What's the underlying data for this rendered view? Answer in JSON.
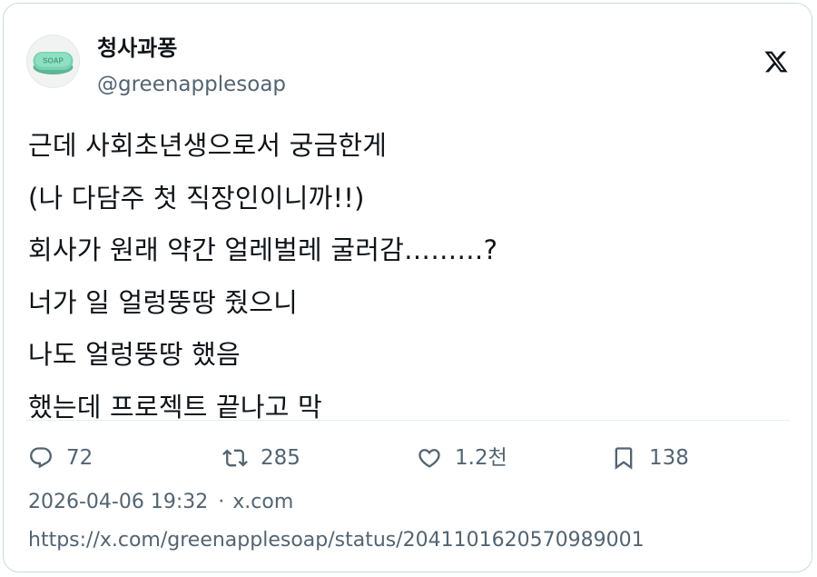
{
  "author": {
    "display_name": "청사과퐁",
    "handle": "@greenapplesoap",
    "avatar_icon": "green-soap-bar",
    "avatar_text": "SOAP"
  },
  "platform_icon": "x-logo-icon",
  "body_lines": [
    "근데 사회초년생으로서 궁금한게",
    "(나 다담주 첫 직장인이니까!!)",
    "회사가 원래 약간 얼레벌레 굴러감………?",
    "너가 일 얼렁뚱땅 줬으니",
    "나도 얼렁뚱땅 했음",
    "했는데 프로젝트 끝나고 막"
  ],
  "actions": {
    "reply": {
      "icon": "reply-bubble-icon",
      "count": "72"
    },
    "repost": {
      "icon": "repost-icon",
      "count": "285"
    },
    "like": {
      "icon": "heart-icon",
      "count": "1.2천"
    },
    "bookmark": {
      "icon": "bookmark-icon",
      "count": "138"
    }
  },
  "meta": {
    "timestamp": "2026-04-06 19:32",
    "separator": "·",
    "source": "x.com"
  },
  "url": "https://x.com/greenapplesoap/status/2041101620570989001",
  "colors": {
    "text": "#0f1419",
    "secondary": "#536471",
    "border": "#cfd9de",
    "divider": "#e6ecf0",
    "soap": "#6fc9a9"
  }
}
